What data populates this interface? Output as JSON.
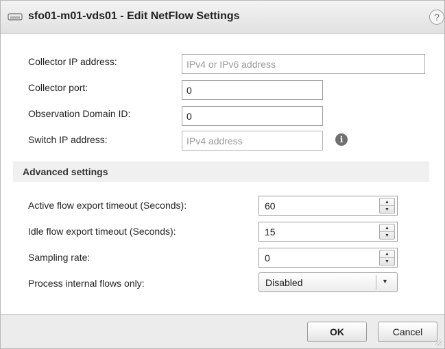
{
  "dialog": {
    "title": "sfo01-m01-vds01 - Edit NetFlow Settings",
    "title_icon": "switch-icon",
    "help_glyph": "?"
  },
  "fields": {
    "collector_ip": {
      "label": "Collector IP address:",
      "value": "",
      "placeholder": "IPv4 or IPv6 address"
    },
    "collector_port": {
      "label": "Collector port:",
      "value": "0"
    },
    "observation_domain_id": {
      "label": "Observation Domain ID:",
      "value": "0"
    },
    "switch_ip": {
      "label": "Switch IP address:",
      "value": "",
      "placeholder": "IPv4 address",
      "info_icon": "info-icon"
    }
  },
  "advanced": {
    "title": "Advanced settings",
    "active_timeout": {
      "label": "Active flow export timeout (Seconds):",
      "value": "60"
    },
    "idle_timeout": {
      "label": "Idle flow export timeout (Seconds):",
      "value": "15"
    },
    "sampling_rate": {
      "label": "Sampling rate:",
      "value": "0"
    },
    "internal_flows": {
      "label": "Process internal flows only:",
      "value": "Disabled"
    }
  },
  "footer": {
    "ok_label": "OK",
    "cancel_label": "Cancel"
  },
  "colors": {
    "titlebar": "#e6e6e6",
    "section_bg": "#f0f0f0",
    "footer_bg": "#ececec"
  }
}
